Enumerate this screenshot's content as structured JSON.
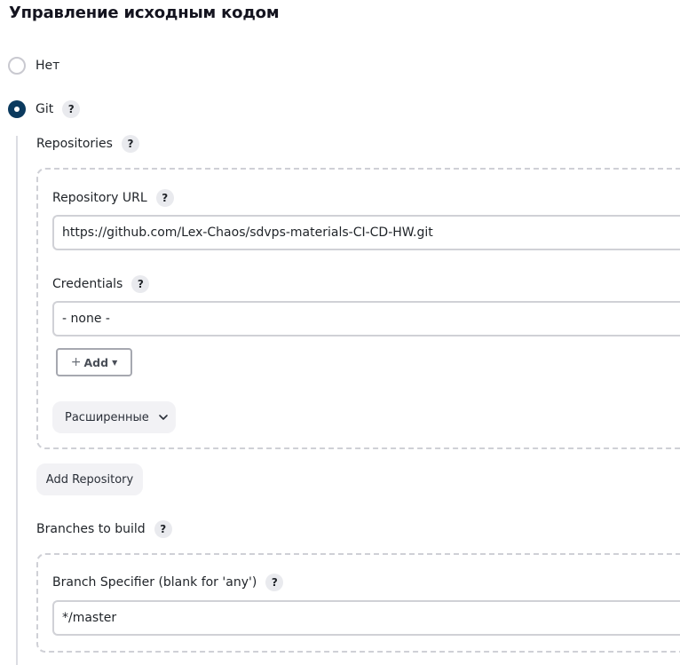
{
  "section": {
    "title": "Управление исходным кодом"
  },
  "scm_options": {
    "none_label": "Нет",
    "git_label": "Git",
    "selected": "git"
  },
  "help_glyph": "?",
  "repositories": {
    "label": "Repositories",
    "repository_url_label": "Repository URL",
    "repository_url_value": "https://github.com/Lex-Chaos/sdvps-materials-CI-CD-HW.git",
    "credentials_label": "Credentials",
    "credentials_value": "- none -",
    "add_button": {
      "plus": "+",
      "label": "Add"
    },
    "advanced_label": "Расширенные",
    "add_repository_label": "Add Repository"
  },
  "branches": {
    "label": "Branches to build",
    "branch_specifier_label": "Branch Specifier (blank for 'any')",
    "branch_specifier_value": "*/master"
  }
}
